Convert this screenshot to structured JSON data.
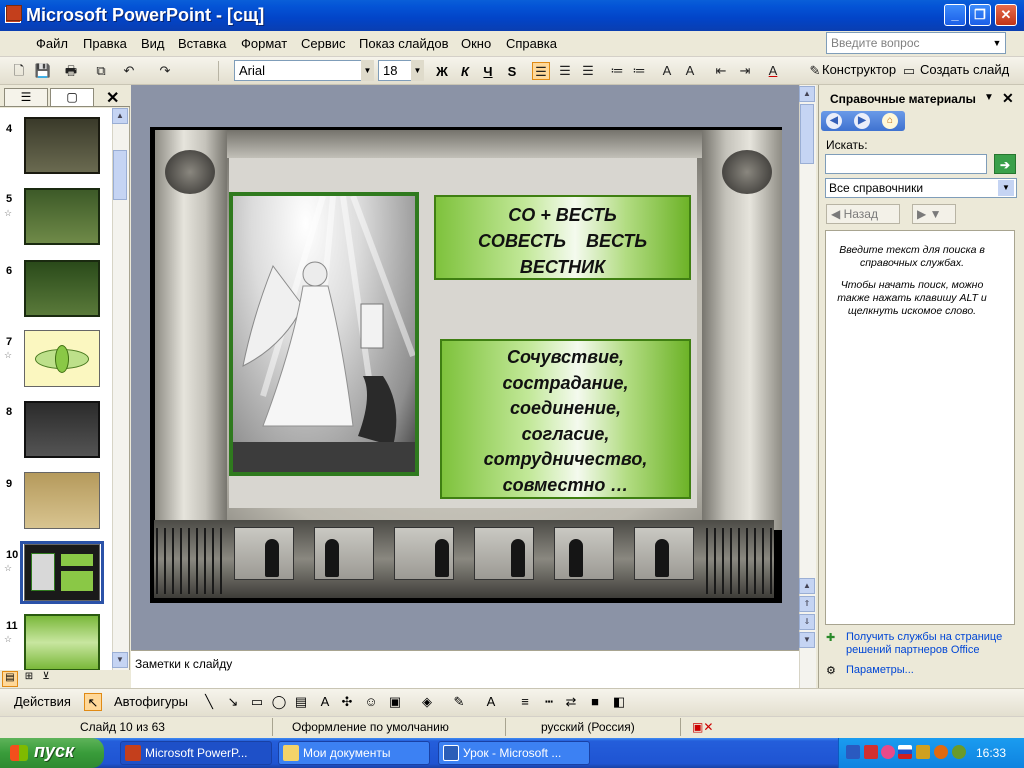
{
  "window": {
    "title": "Microsoft PowerPoint - [сщ]",
    "app_icon": "powerpoint-icon"
  },
  "menu": {
    "items": [
      "Файл",
      "Правка",
      "Вид",
      "Вставка",
      "Формат",
      "Сервис",
      "Показ слайдов",
      "Окно",
      "Справка"
    ],
    "help_placeholder": "Введите вопрос"
  },
  "toolbar": {
    "font": "Arial",
    "size": "18",
    "bold": "Ж",
    "italic": "К",
    "underline": "Ч",
    "shadow": "S",
    "designer_label": "Конструктор",
    "new_slide_label": "Создать слайд"
  },
  "slides_pane": {
    "items": [
      {
        "num": "4",
        "star": false,
        "theme": "dark-text"
      },
      {
        "num": "5",
        "star": true,
        "theme": "dark-green-text"
      },
      {
        "num": "6",
        "star": false,
        "theme": "dark-green-table"
      },
      {
        "num": "7",
        "star": true,
        "theme": "yellow-diagram"
      },
      {
        "num": "8",
        "star": false,
        "theme": "dark-table"
      },
      {
        "num": "9",
        "star": false,
        "theme": "tan-text"
      },
      {
        "num": "10",
        "star": true,
        "theme": "current-angel",
        "selected": true
      },
      {
        "num": "11",
        "star": true,
        "theme": "green-text"
      }
    ]
  },
  "slide": {
    "box1_lines": [
      "СО + ВЕСТЬ",
      "СОВЕСТЬ    ВЕСТЬ",
      "ВЕСТНИК"
    ],
    "box2_lines": [
      "Сочувствие,",
      "сострадание,",
      "соединение,",
      "согласие,",
      "сотрудничество,",
      "совместно …"
    ]
  },
  "notes": {
    "placeholder": "Заметки к слайду"
  },
  "task_pane": {
    "title": "Справочные материалы",
    "search_label": "Искать:",
    "search_value": "",
    "scope": "Все справочники",
    "back_label": "Назад",
    "info_1": "Введите текст для поиска в справочных службах.",
    "info_2": "Чтобы начать поиск, можно также нажать клавишу ALT и щелкнуть искомое слово.",
    "link_services": "Получить службы на странице решений партнеров Office",
    "link_params": "Параметры..."
  },
  "drawbar": {
    "actions_label": "Действия",
    "autoshapes_label": "Автофигуры"
  },
  "statusbar": {
    "slide_info": "Слайд 10 из 63",
    "design": "Оформление по умолчанию",
    "language": "русский (Россия)"
  },
  "taskbar": {
    "start_label": "пуск",
    "buttons": [
      {
        "label": "Microsoft PowerP...",
        "icon": "powerpoint-icon",
        "active": true
      },
      {
        "label": "Мои документы",
        "icon": "folder-icon",
        "active": false
      },
      {
        "label": "Урок - Microsoft ...",
        "icon": "word-icon",
        "active": false
      }
    ],
    "clock": "16:33"
  },
  "colors": {
    "title_blue": "#0454d6",
    "slide_green": "#7ec23c",
    "selected_thumb": "#2b52a8"
  }
}
